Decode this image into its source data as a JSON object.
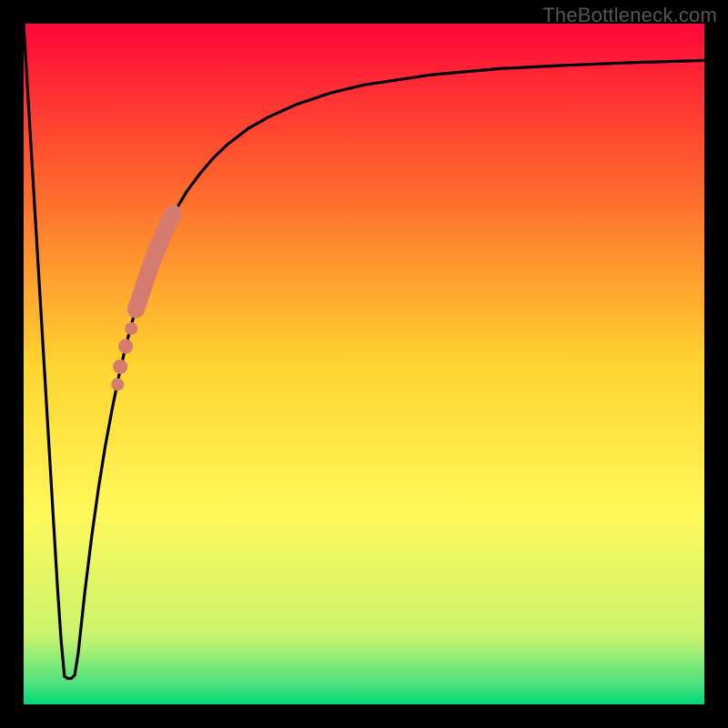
{
  "watermark": "TheBottleneck.com",
  "chart_data": {
    "type": "line",
    "title": "",
    "xlabel": "",
    "ylabel": "",
    "xlim": [
      0,
      100
    ],
    "ylim": [
      0,
      100
    ],
    "grid": false,
    "legend": false,
    "background": {
      "type": "vertical-gradient",
      "stops": [
        {
          "pos": 0.0,
          "color": "#ff073a"
        },
        {
          "pos": 0.25,
          "color": "#ff6b2d"
        },
        {
          "pos": 0.5,
          "color": "#ffd430"
        },
        {
          "pos": 0.72,
          "color": "#fff95a"
        },
        {
          "pos": 0.9,
          "color": "#c9f46e"
        },
        {
          "pos": 0.97,
          "color": "#4de27e"
        },
        {
          "pos": 1.0,
          "color": "#00d977"
        }
      ]
    },
    "series": [
      {
        "name": "bottleneck-curve",
        "color": "#000000",
        "x": [
          0.0,
          1.0,
          2.0,
          3.0,
          4.0,
          5.0,
          5.5,
          6.0,
          6.5,
          7.0,
          7.5,
          8.0,
          8.5,
          9.0,
          10.0,
          11.0,
          12.0,
          13.0,
          14.0,
          15.0,
          16.0,
          18.0,
          20.0,
          22.0,
          24.0,
          26.0,
          28.0,
          30.0,
          33.0,
          36.0,
          40.0,
          45.0,
          50.0,
          60.0,
          70.0,
          80.0,
          90.0,
          100.0
        ],
        "values": [
          100,
          83.3,
          66.7,
          50.0,
          33.3,
          16.7,
          9.4,
          4.1,
          3.8,
          3.8,
          4.3,
          7.4,
          12.0,
          16.6,
          24.7,
          31.8,
          38.0,
          43.4,
          48.3,
          52.6,
          56.4,
          62.9,
          68.0,
          72.1,
          75.4,
          78.1,
          80.4,
          82.3,
          84.6,
          86.3,
          88.1,
          89.8,
          91.0,
          92.5,
          93.4,
          93.9,
          94.3,
          94.6
        ]
      }
    ],
    "highlight_segment": {
      "name": "salmon-overlay",
      "color": "#d57b6f",
      "points": [
        {
          "x": 16.5,
          "y": 58.0,
          "r": 8
        },
        {
          "x": 17.0,
          "y": 59.5,
          "r": 9
        },
        {
          "x": 17.5,
          "y": 61.0,
          "r": 10
        },
        {
          "x": 18.0,
          "y": 62.5,
          "r": 10
        },
        {
          "x": 18.5,
          "y": 64.0,
          "r": 10
        },
        {
          "x": 19.0,
          "y": 65.3,
          "r": 10
        },
        {
          "x": 19.5,
          "y": 66.6,
          "r": 10
        },
        {
          "x": 20.0,
          "y": 67.8,
          "r": 10
        },
        {
          "x": 20.5,
          "y": 69.0,
          "r": 10
        },
        {
          "x": 21.0,
          "y": 70.1,
          "r": 10
        },
        {
          "x": 21.5,
          "y": 71.1,
          "r": 10
        },
        {
          "x": 22.0,
          "y": 72.1,
          "r": 9
        }
      ],
      "gap_points": [
        {
          "x": 15.0,
          "y": 52.6,
          "r": 8
        },
        {
          "x": 15.8,
          "y": 55.2,
          "r": 7
        },
        {
          "x": 14.2,
          "y": 49.6,
          "r": 8
        },
        {
          "x": 13.8,
          "y": 47.0,
          "r": 7
        }
      ]
    },
    "frame_color": "#000000",
    "frame_thickness_px": 26
  }
}
